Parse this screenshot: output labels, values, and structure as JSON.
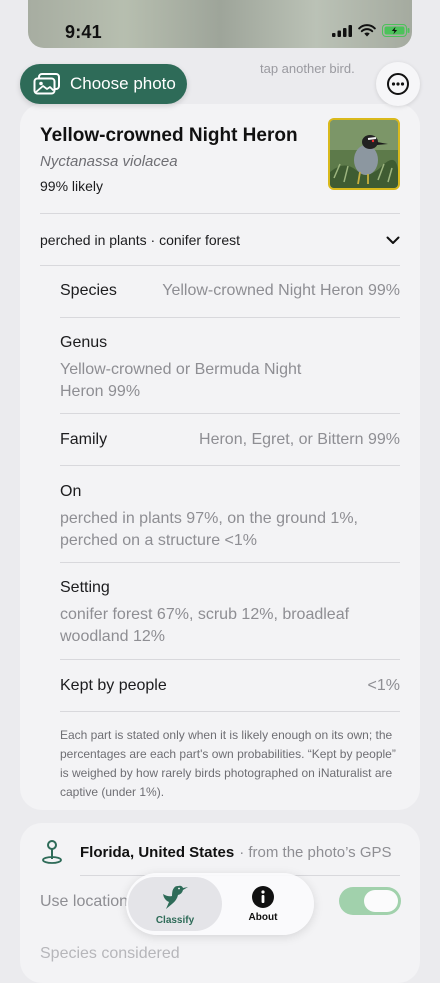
{
  "status_bar": {
    "time": "9:41",
    "icons": [
      "signal-icon",
      "wifi-icon",
      "battery-icon"
    ]
  },
  "behind_hint": "tap another bird.",
  "toolbar": {
    "choose_photo_label": "Choose photo",
    "more_icon": "ellipsis-circle-icon"
  },
  "result": {
    "common_name": "Yellow-crowned Night Heron",
    "scientific_name": "Nyctanassa violacea",
    "likelihood": "99% likely",
    "summary": "perched in plants · conifer forest",
    "rows": {
      "species": {
        "label": "Species",
        "value": "Yellow-crowned Night Heron 99%"
      },
      "genus": {
        "label": "Genus",
        "value": "Yellow-crowned or Bermuda Night Heron 99%"
      },
      "family": {
        "label": "Family",
        "value": "Heron, Egret, or Bittern 99%"
      },
      "on": {
        "label": "On",
        "value": "perched in plants 97%, on the ground 1%, perched on a structure <1%"
      },
      "setting": {
        "label": "Setting",
        "value": "conifer forest 67%, scrub 12%, broadleaf woodland 12%"
      },
      "kept": {
        "label": "Kept by people",
        "value": "<1%"
      }
    },
    "footnote": "Each part is stated only when it is likely enough on its own; the percentages are each part's own probabilities. “Kept by people” is weighed by how rarely birds photographed on iNaturalist are captive (under 1%)."
  },
  "location": {
    "place": "Florida, United States",
    "source": "· from the photo’s GPS",
    "use_location_label": "Use location",
    "use_location_on": true,
    "species_considered_label": "Species considered"
  },
  "tabs": [
    {
      "label": "Classify",
      "icon": "hummingbird-icon",
      "active": true
    },
    {
      "label": "About",
      "icon": "info-circle-icon",
      "active": false
    }
  ],
  "colors": {
    "accent": "#2e6b58",
    "thumb_border": "#d9b91c",
    "toggle_on": "#7fc48e"
  }
}
